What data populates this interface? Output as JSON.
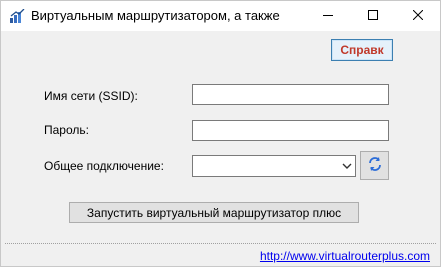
{
  "window": {
    "title": "Виртуальным маршрутизатором, а также",
    "icon": "router-app-icon"
  },
  "controls": {
    "minimize_icon": "minimize-icon",
    "maximize_icon": "maximize-icon",
    "close_icon": "close-icon"
  },
  "help": {
    "label": "Справк",
    "text_color": "#c0392b",
    "border_color": "#3c7fb1"
  },
  "form": {
    "ssid_label": "Имя сети (SSID):",
    "ssid_value": "",
    "password_label": "Пароль:",
    "password_value": "",
    "connection_label": "Общее подключение:",
    "connection_value": "",
    "refresh_icon": "refresh-icon"
  },
  "actions": {
    "start_label": "Запустить виртуальный маршрутизатор плюс"
  },
  "footer": {
    "link_text": "http://www.virtualrouterplus.com",
    "link_color": "#0000ee"
  }
}
